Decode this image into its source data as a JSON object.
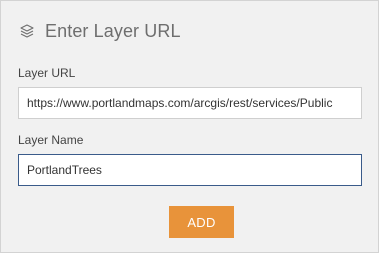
{
  "header": {
    "title": "Enter Layer URL",
    "icon": "layers-icon"
  },
  "form": {
    "layer_url": {
      "label": "Layer URL",
      "value": "https://www.portlandmaps.com/arcgis/rest/services/Public"
    },
    "layer_name": {
      "label": "Layer Name",
      "value": "PortlandTrees"
    }
  },
  "actions": {
    "add_label": "ADD"
  },
  "colors": {
    "panel_background": "#f1f1f1",
    "accent_button": "#e8933a",
    "focused_border": "#3a5b8a",
    "title_text": "#6e6e6e"
  }
}
